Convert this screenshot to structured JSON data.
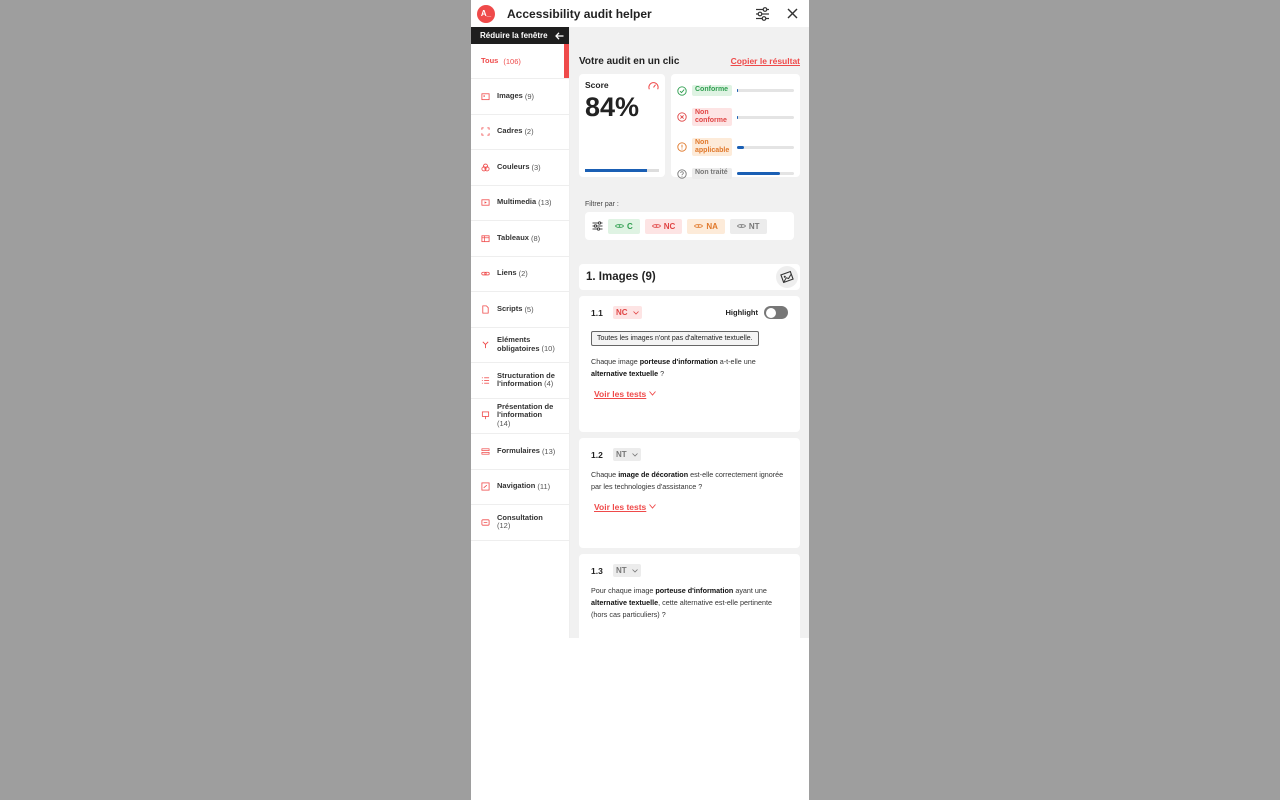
{
  "app": {
    "title": "Accessibility audit helper",
    "logo_text": "A_"
  },
  "sidebar": {
    "collapse_label": "Réduire la fenêtre",
    "items": [
      {
        "label": "Tous",
        "count": "(106)"
      },
      {
        "label": "Images",
        "count": "(9)"
      },
      {
        "label": "Cadres",
        "count": "(2)"
      },
      {
        "label": "Couleurs",
        "count": "(3)"
      },
      {
        "label": "Multimedia",
        "count": "(13)"
      },
      {
        "label": "Tableaux",
        "count": "(8)"
      },
      {
        "label": "Liens",
        "count": "(2)"
      },
      {
        "label": "Scripts",
        "count": "(5)"
      },
      {
        "label": "Eléments obligatoires",
        "count": "(10)"
      },
      {
        "label": "Structuration de l'information",
        "count": "(4)"
      },
      {
        "label": "Présentation de l'information",
        "count": "(14)"
      },
      {
        "label": "Formulaires",
        "count": "(13)"
      },
      {
        "label": "Navigation",
        "count": "(11)"
      },
      {
        "label": "Consultation",
        "count": "(12)"
      }
    ]
  },
  "main": {
    "title": "Votre audit en un clic",
    "copy_label": "Copier le résultat",
    "score": {
      "label": "Score",
      "value": "84%",
      "fraction": 0.84
    },
    "statuses": [
      {
        "label": "Conforme",
        "fraction": 0.02
      },
      {
        "label": "Non conforme",
        "fraction": 0.02
      },
      {
        "label": "Non applicable",
        "fraction": 0.12
      },
      {
        "label": "Non traité",
        "fraction": 0.75
      }
    ],
    "filter": {
      "label": "Filtrer par :",
      "buttons": [
        "C",
        "NC",
        "NA",
        "NT"
      ]
    },
    "section": {
      "title": "1. Images (9)"
    },
    "criteria": [
      {
        "num": "1.1",
        "status": "NC",
        "highlight_label": "Highlight",
        "note": "Toutes les images n'ont pas d'alternative textuelle.",
        "t1": "Chaque image ",
        "b1": "porteuse d'information",
        "t2": " a-t-elle une ",
        "b2": "alternative textuelle",
        "t3": " ?",
        "see_tests": "Voir les tests"
      },
      {
        "num": "1.2",
        "status": "NT",
        "t1": "Chaque ",
        "b1": "image de décoration",
        "t2": " est-elle correctement ignorée par les technologies d'assistance ?",
        "see_tests": "Voir les tests"
      },
      {
        "num": "1.3",
        "status": "NT",
        "t1": "Pour chaque image ",
        "b1": "porteuse d'information",
        "t2": " ayant une ",
        "b2": "alternative textuelle",
        "t3": ", cette alternative est-elle pertinente (hors cas particuliers) ?"
      }
    ]
  },
  "colors": {
    "accent": "#ef4a4a",
    "conforme_bg": "#dff3e3",
    "conforme_fg": "#2e9e4f",
    "nc_bg": "#fde4e4",
    "nc_fg": "#e04545",
    "na_bg": "#fdebd9",
    "na_fg": "#e0782a",
    "nt_bg": "#ececec",
    "nt_fg": "#777777",
    "bar": "#1a5fb4"
  }
}
